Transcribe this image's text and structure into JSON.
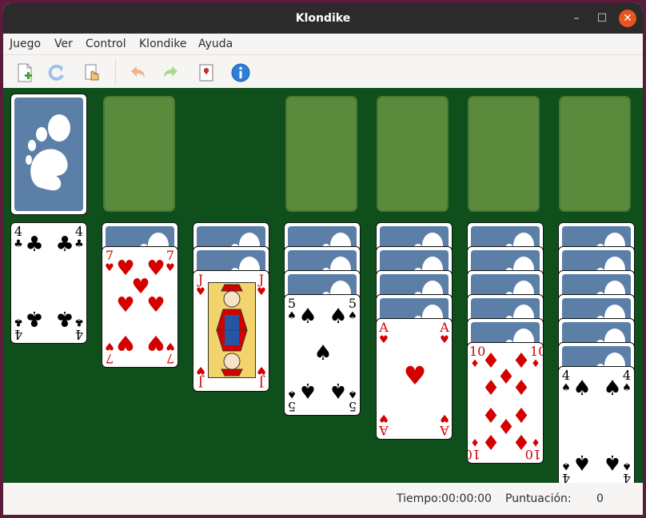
{
  "window": {
    "title": "Klondike"
  },
  "menu": [
    "Juego",
    "Ver",
    "Control",
    "Klondike",
    "Ayuda"
  ],
  "toolbar": {
    "icons": [
      "new-game-icon",
      "restart-icon",
      "deal-icon",
      "undo-icon",
      "redo-icon",
      "hint-icon",
      "info-icon"
    ]
  },
  "status": {
    "time_label": "Tiempo:",
    "time_value": "00:00:00",
    "score_label": "Puntuación:",
    "score_value": "0"
  },
  "colors": {
    "felt": "#0f4f1c",
    "slot": "#5a8a3c",
    "card_back": "#5c7fa8",
    "red_suit": "#d40000",
    "close_button": "#e9541f"
  },
  "tableau": [
    {
      "rank": "4",
      "suit": "♣",
      "color": "black"
    },
    {
      "rank": "7",
      "suit": "♥",
      "color": "red"
    },
    {
      "rank": "J",
      "suit": "♥",
      "color": "red"
    },
    {
      "rank": "5",
      "suit": "♠",
      "color": "black"
    },
    {
      "rank": "A",
      "suit": "♥",
      "color": "red"
    },
    {
      "rank": "10",
      "suit": "♦",
      "color": "red"
    },
    {
      "rank": "4",
      "suit": "♠",
      "color": "black"
    }
  ]
}
